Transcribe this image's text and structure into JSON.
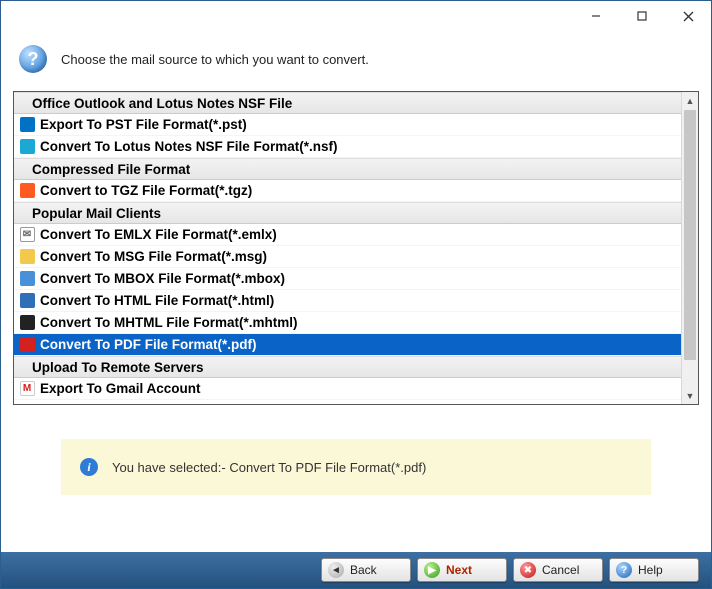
{
  "header": {
    "prompt": "Choose the mail source to which you want to convert."
  },
  "groups": [
    {
      "type": "group",
      "label": "Office Outlook and Lotus Notes NSF File"
    },
    {
      "type": "item",
      "icon": "outlook",
      "label": "Export To PST File Format(*.pst)"
    },
    {
      "type": "item",
      "icon": "nsf",
      "label": "Convert To Lotus Notes NSF File Format(*.nsf)"
    },
    {
      "type": "group",
      "label": "Compressed File Format"
    },
    {
      "type": "item",
      "icon": "tgz",
      "label": "Convert to TGZ File Format(*.tgz)"
    },
    {
      "type": "group",
      "label": "Popular Mail Clients"
    },
    {
      "type": "item",
      "icon": "emlx",
      "label": "Convert To EMLX File Format(*.emlx)"
    },
    {
      "type": "item",
      "icon": "msg",
      "label": "Convert To MSG File Format(*.msg)"
    },
    {
      "type": "item",
      "icon": "mbox",
      "label": "Convert To MBOX File Format(*.mbox)"
    },
    {
      "type": "item",
      "icon": "html",
      "label": "Convert To HTML File Format(*.html)"
    },
    {
      "type": "item",
      "icon": "mhtml",
      "label": "Convert To MHTML File Format(*.mhtml)"
    },
    {
      "type": "item",
      "icon": "pdf",
      "label": "Convert To PDF File Format(*.pdf)",
      "selected": true
    },
    {
      "type": "group",
      "label": "Upload To Remote Servers"
    },
    {
      "type": "item",
      "icon": "gmail",
      "label": "Export To Gmail Account"
    }
  ],
  "info": {
    "text": "You have selected:- Convert To PDF File Format(*.pdf)"
  },
  "footer": {
    "back": "Back",
    "next": "Next",
    "cancel": "Cancel",
    "help": "Help"
  }
}
